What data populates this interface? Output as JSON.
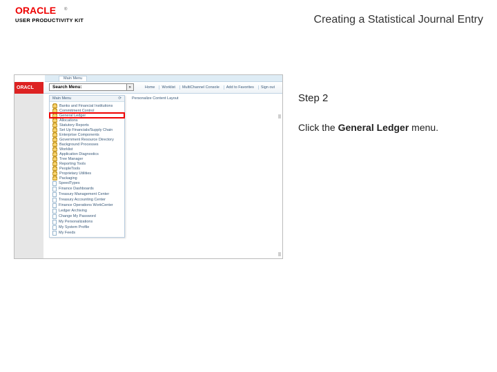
{
  "header": {
    "brand": "ORACLE",
    "product_line": "USER PRODUCTIVITY KIT",
    "page_title": "Creating a Statistical Journal Entry"
  },
  "instructions": {
    "step_label": "Step 2",
    "text_before": "Click the ",
    "bold": "General Ledger",
    "text_after": " menu."
  },
  "screenshot": {
    "oracle_strip": "ORACL",
    "tabs": [
      "Main Menu"
    ],
    "nav_links": [
      "Home",
      "Worklist",
      "MultiChannel Console",
      "Add to Favorites",
      "Sign out"
    ],
    "search_label": "Search Menu:",
    "search_go": "»",
    "breadcrumb": "Personalize Content   Layout",
    "menu_header_left": "Main Menu",
    "menu_header_right": "⟳",
    "menu_items": [
      {
        "icon": "folder",
        "label": "Banks and Financial Institutions"
      },
      {
        "icon": "folder",
        "label": "Commitment Control"
      },
      {
        "icon": "folder",
        "label": "General Ledger",
        "highlight": true
      },
      {
        "icon": "folder",
        "label": "Allocations"
      },
      {
        "icon": "folder",
        "label": "Statutory Reports"
      },
      {
        "icon": "folder",
        "label": "Set Up Financials/Supply Chain"
      },
      {
        "icon": "folder",
        "label": "Enterprise Components"
      },
      {
        "icon": "folder",
        "label": "Government Resource Directory"
      },
      {
        "icon": "folder",
        "label": "Background Processes"
      },
      {
        "icon": "folder",
        "label": "Worklist"
      },
      {
        "icon": "folder",
        "label": "Application Diagnostics"
      },
      {
        "icon": "folder",
        "label": "Tree Manager"
      },
      {
        "icon": "folder",
        "label": "Reporting Tools"
      },
      {
        "icon": "folder",
        "label": "PeopleTools"
      },
      {
        "icon": "folder",
        "label": "Proprietary Utilities"
      },
      {
        "icon": "folder",
        "label": "Packaging"
      },
      {
        "icon": "doc",
        "label": "SpeedTypes"
      },
      {
        "icon": "doc",
        "label": "Finance Dashboards"
      },
      {
        "icon": "doc",
        "label": "Treasury Management Center"
      },
      {
        "icon": "doc",
        "label": "Treasury Accounting Center"
      },
      {
        "icon": "doc",
        "label": "Finance Operations WorkCenter"
      },
      {
        "icon": "doc",
        "label": "Ledger Archiving"
      },
      {
        "icon": "doc",
        "label": "Change My Password"
      },
      {
        "icon": "doc",
        "label": "My Personalizations"
      },
      {
        "icon": "doc",
        "label": "My System Profile"
      },
      {
        "icon": "doc",
        "label": "My Feeds"
      }
    ]
  }
}
